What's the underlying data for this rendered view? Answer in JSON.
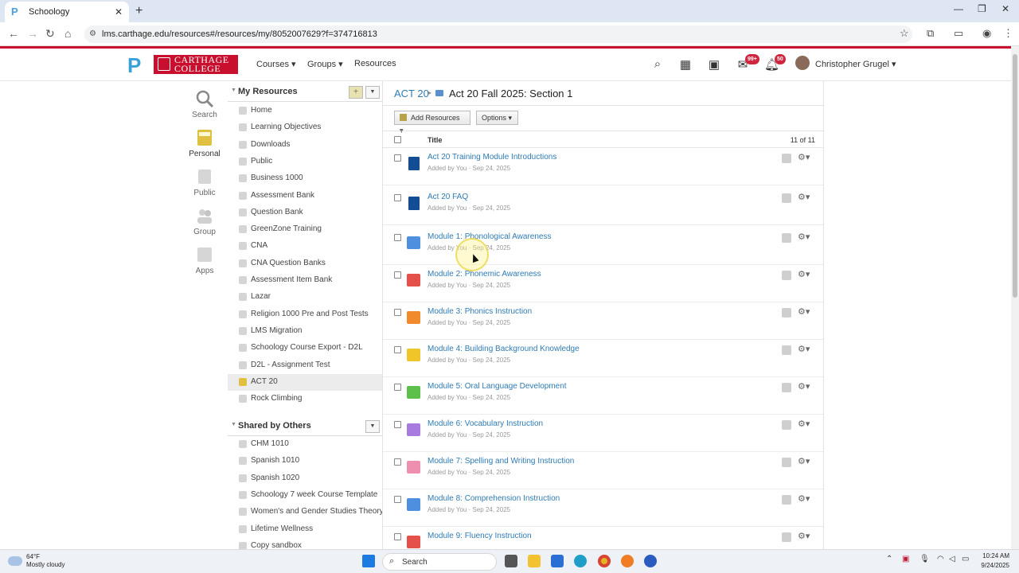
{
  "browser": {
    "tab_title": "Schoology",
    "url": "lms.carthage.edu/resources#/resources/my/8052007629?f=374716813"
  },
  "header": {
    "logo_text_line1": "CARTHAGE",
    "logo_text_line2": "COLLEGE",
    "nav": [
      "Courses",
      "Groups",
      "Resources"
    ],
    "messages_badge": "99+",
    "notifications_badge": "50",
    "user_name": "Christopher Grugel"
  },
  "rail": {
    "search": "Search",
    "personal": "Personal",
    "public": "Public",
    "group": "Group",
    "apps": "Apps"
  },
  "sidebar": {
    "my_resources_title": "My Resources",
    "my_items": [
      "Home",
      "Learning Objectives",
      "Downloads",
      "Public",
      "Business 1000",
      "Assessment Bank",
      "Question Bank",
      "GreenZone Training",
      "CNA",
      "CNA Question Banks",
      "Assessment Item Bank",
      "Lazar",
      "Religion 1000 Pre and Post Tests",
      "LMS Migration",
      "Schoology Course Export - D2L",
      "D2L - Assignment Test",
      "ACT 20",
      "Rock Climbing"
    ],
    "active_item": "ACT 20",
    "shared_title": "Shared by Others",
    "shared_items": [
      "CHM 1010",
      "Spanish 1010",
      "Spanish 1020",
      "Schoology 7 week Course Template",
      "Women's and Gender Studies Theory",
      "Lifetime Wellness",
      "Copy sandbox"
    ]
  },
  "main": {
    "breadcrumb_root": "ACT 20",
    "breadcrumb_current": "Act 20 Fall 2025: Section 1",
    "add_resources": "Add Resources",
    "options": "Options",
    "column_title": "Title",
    "count": "11 of 11",
    "rows": [
      {
        "title": "Act 20 Training Module Introductions",
        "sub": "Added by You · Sep 24, 2025",
        "icon": "doc",
        "color": "#134d96"
      },
      {
        "title": "Act 20 FAQ",
        "sub": "Added by You · Sep 24, 2025",
        "icon": "doc",
        "color": "#134d96"
      },
      {
        "title": "Module 1: Phonological Awareness",
        "sub": "Added by You · Sep 24, 2025",
        "icon": "folder",
        "color": "#4f8fe0"
      },
      {
        "title": "Module 2: Phonemic Awareness",
        "sub": "Added by You · Sep 24, 2025",
        "icon": "folder",
        "color": "#e5514a"
      },
      {
        "title": "Module 3: Phonics Instruction",
        "sub": "Added by You · Sep 24, 2025",
        "icon": "folder",
        "color": "#f08a2a"
      },
      {
        "title": "Module 4: Building Background Knowledge",
        "sub": "Added by You · Sep 24, 2025",
        "icon": "folder",
        "color": "#f0c52a"
      },
      {
        "title": "Module 5: Oral Language Development",
        "sub": "Added by You · Sep 24, 2025",
        "icon": "folder",
        "color": "#5cc04a"
      },
      {
        "title": "Module 6: Vocabulary Instruction",
        "sub": "Added by You · Sep 24, 2025",
        "icon": "folder",
        "color": "#a77be0"
      },
      {
        "title": "Module 7: Spelling and Writing Instruction",
        "sub": "Added by You · Sep 24, 2025",
        "icon": "folder",
        "color": "#ef8fb0"
      },
      {
        "title": "Module 8: Comprehension Instruction",
        "sub": "Added by You · Sep 24, 2025",
        "icon": "folder",
        "color": "#4f8fe0"
      },
      {
        "title": "Module 9: Fluency Instruction",
        "sub": "",
        "icon": "folder",
        "color": "#e5514a"
      }
    ]
  },
  "taskbar": {
    "temp": "64°F",
    "weather": "Mostly cloudy",
    "search": "Search",
    "time": "10:24 AM",
    "date": "9/24/2025"
  }
}
